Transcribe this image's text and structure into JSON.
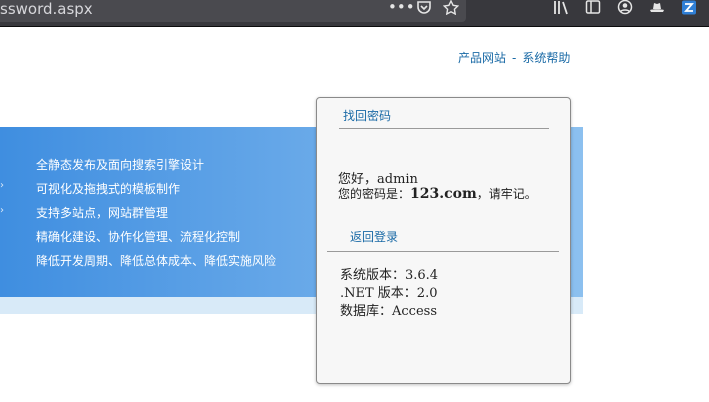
{
  "browser": {
    "url_fragment": "ssword.aspx",
    "icons": [
      "more-icon",
      "pocket-icon",
      "bookmark-star-icon",
      "library-icon",
      "sidebar-icon",
      "account-icon",
      "hat-icon",
      "extension-icon"
    ]
  },
  "header": {
    "links": [
      "产品网站",
      "系统帮助"
    ],
    "separator": "-"
  },
  "banner": {
    "features": [
      "全静态发布及面向搜索引擎设计",
      "可视化及拖拽式的模板制作",
      "支持多站点，网站群管理",
      "精确化建设、协作化管理、流程化控制",
      "降低开发周期、降低总体成本、降低实施风险"
    ]
  },
  "card": {
    "title": "找回密码",
    "greeting": "您好，admin",
    "password_prefix": "您的密码是：",
    "password": "123.com",
    "password_suffix": "，请牢记。",
    "back_link": "返回登录",
    "info": {
      "version": "系统版本：3.6.4",
      "net_version": ".NET 版本：2.0",
      "database": "数据库：Access"
    }
  }
}
